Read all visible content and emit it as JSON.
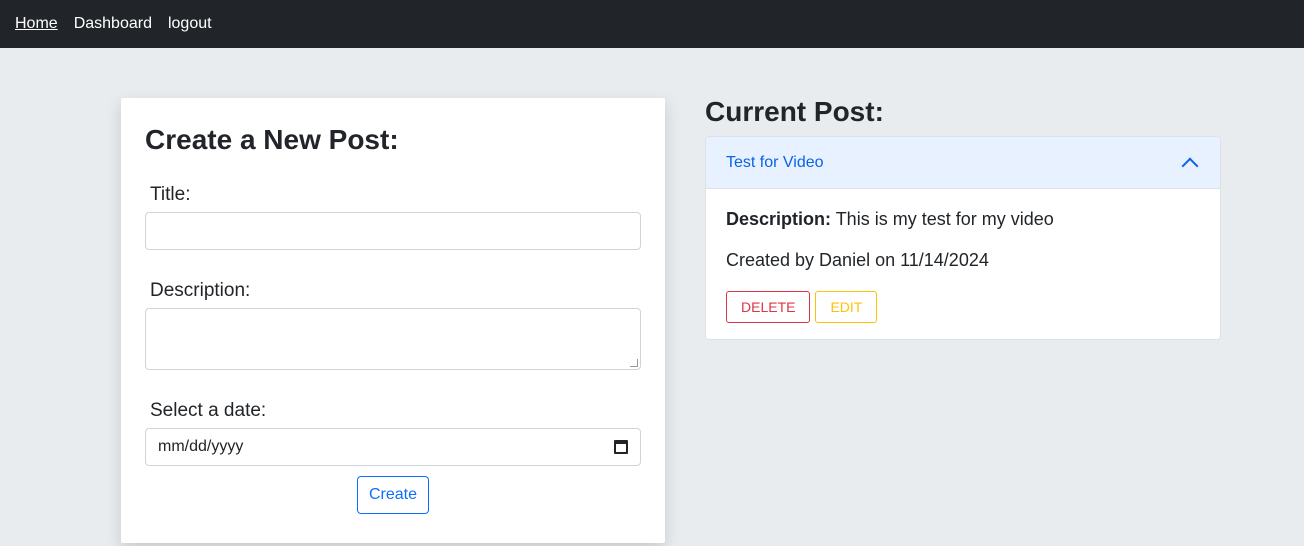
{
  "nav": {
    "links": [
      {
        "label": "Home"
      },
      {
        "label": "Dashboard"
      },
      {
        "label": "logout"
      }
    ]
  },
  "create_form": {
    "title": "Create a New Post:",
    "title_label": "Title:",
    "title_value": "",
    "description_label": "Description:",
    "description_value": "",
    "date_label": "Select a date:",
    "date_placeholder": "mm/dd/yyyy",
    "submit_label": "Create"
  },
  "current_post": {
    "section_title": "Current Post:",
    "post_title": "Test for Video",
    "description_label": "Description:",
    "description_text": " This is my test for my video",
    "created_by": "Created by Daniel on 11/14/2024",
    "delete_label": "DELETE",
    "edit_label": "EDIT"
  },
  "colors": {
    "navbar": "#212529",
    "primary": "#0d6efd",
    "danger": "#dc3545",
    "warning": "#ffc107"
  }
}
